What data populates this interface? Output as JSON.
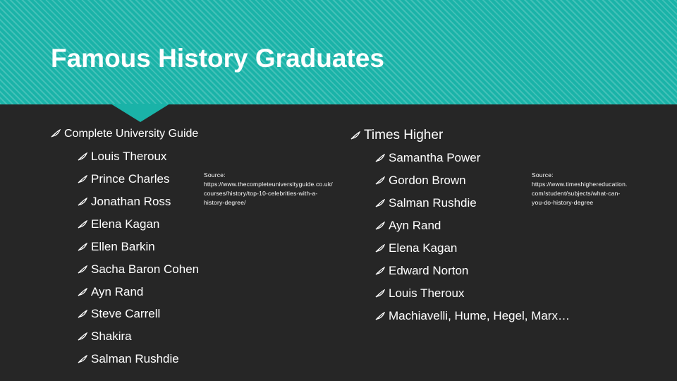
{
  "slide": {
    "title": "Famous History Graduates",
    "colors": {
      "accent": "#1ab3a8",
      "background": "#262626",
      "text": "#ffffff"
    }
  },
  "left": {
    "heading": "Complete University Guide",
    "items": [
      "Louis Theroux",
      "Prince Charles",
      "Jonathan Ross",
      "Elena Kagan",
      "Ellen Barkin",
      "Sacha Baron Cohen",
      "Ayn Rand",
      "Steve Carrell",
      "Shakira",
      "Salman Rushdie"
    ],
    "source_lines": [
      "Source:",
      "https://www.thecompleteuniversityguide.co.uk/",
      "courses/history/top-10-celebrities-with-a-",
      "history-degree/"
    ]
  },
  "right": {
    "heading": "Times Higher",
    "items": [
      "Samantha Power",
      "Gordon Brown",
      "Salman Rushdie",
      "Ayn Rand",
      "Elena Kagan",
      "Edward Norton",
      "Louis Theroux",
      "Machiavelli, Hume, Hegel, Marx…"
    ],
    "source_lines": [
      "Source:",
      "https://www.timeshighereducation.",
      "com/student/subjects/what-can-",
      "you-do-history-degree"
    ]
  },
  "icons": {
    "bullet": "feather-icon"
  }
}
